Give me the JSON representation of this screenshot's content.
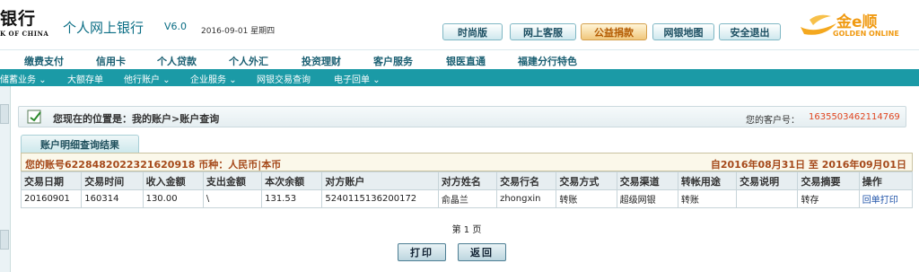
{
  "header": {
    "bank_name": "银行",
    "bank_en": "K OF CHINA",
    "app_title": "个人网上银行",
    "version": "V6.0",
    "date": "2016-09-01 星期四",
    "buttons": [
      "时尚版",
      "网上客服",
      "公益捐款",
      "网银地图",
      "安全退出"
    ],
    "logo_text": "金e顺",
    "logo_en": "GOLDEN ONLINE"
  },
  "main_nav": [
    "缴费支付",
    "信用卡",
    "个人贷款",
    "个人外汇",
    "投资理财",
    "客户服务",
    "银医直通",
    "福建分行特色"
  ],
  "sub_nav": [
    "储蓄业务",
    "大额存单",
    "他行账户",
    "企业服务",
    "网银交易查询",
    "电子回单"
  ],
  "location": {
    "text": "您现在的位置是：我的账户>账户查询",
    "customer_label": "您的客户号：",
    "customer_no": "1635503462114769"
  },
  "result_tab": "账户明细查询结果",
  "account_info": {
    "left": "您的账号6228482022321620918 币种：人民币|本币",
    "right": "自2016年08月31日  至  2016年09月01日"
  },
  "table": {
    "headers": [
      "交易日期",
      "交易时间",
      "收入金额",
      "支出金额",
      "本次余额",
      "对方账户",
      "对方姓名",
      "交易行名",
      "交易方式",
      "交易渠道",
      "转帐用途",
      "交易说明",
      "交易摘要",
      "操作"
    ],
    "rows": [
      [
        "20160901",
        "160314",
        "130.00",
        "\\",
        "131.53",
        "5240115136200172",
        "俞晶兰",
        "zhongxin",
        "转账",
        "超级网银",
        "转账",
        "",
        "转存",
        "回单打印"
      ]
    ]
  },
  "pagination": "第 1 页",
  "actions": {
    "print": "打印",
    "back": "返回"
  },
  "colors": {
    "accent": "#1b9aa6",
    "highlight": "#e0451f",
    "info_text": "#a5491a"
  }
}
